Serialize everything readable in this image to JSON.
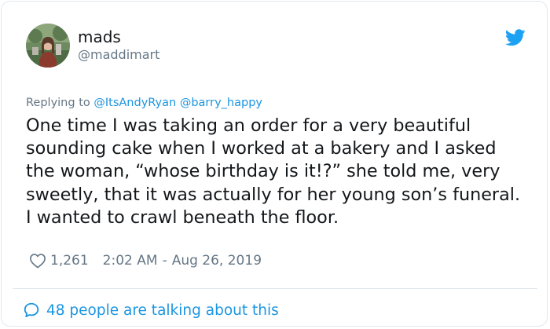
{
  "author": {
    "display_name": "mads",
    "handle": "@maddimart"
  },
  "reply": {
    "prefix": "Replying to",
    "mentions": [
      "@ItsAndyRyan",
      "@barry_happy"
    ]
  },
  "tweet": {
    "text": "One time I was taking an order for a very beautiful sounding cake when I worked at a bakery and I asked the woman, “whose birthday is it!?” she told me, very sweetly, that it was actually for her young son’s funeral. I wanted to crawl beneath the floor."
  },
  "meta": {
    "likes": "1,261",
    "time": "2:02 AM",
    "separator": "-",
    "date": "Aug 26, 2019"
  },
  "conversation": {
    "label": "48 people are talking about this"
  },
  "icons": {
    "logo": "twitter-bird-icon",
    "like": "heart-outline-icon",
    "conversation": "speech-bubble-icon"
  },
  "colors": {
    "brand": "#1da1f2",
    "link": "#1b95e0",
    "secondary_text": "#657786",
    "border": "#e1e8ed"
  }
}
